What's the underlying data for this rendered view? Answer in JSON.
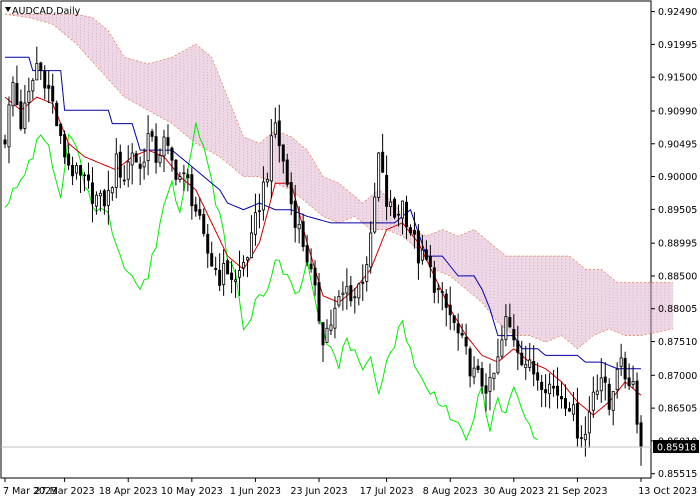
{
  "chart_data": {
    "type": "candlestick",
    "title": "AUDCAD,Daily",
    "symbol": "AUDCAD",
    "timeframe": "Daily",
    "ylim": [
      0.8545,
      0.9265
    ],
    "y_ticks": [
      "0.92490",
      "0.91995",
      "0.91500",
      "0.90990",
      "0.90495",
      "0.90000",
      "0.89505",
      "0.88995",
      "0.88500",
      "0.88005",
      "0.87510",
      "0.87000",
      "0.86505",
      "0.86010",
      "0.85515"
    ],
    "x_ticks": [
      "7 Mar 2023",
      "27 Mar 2023",
      "18 Apr 2023",
      "10 May 2023",
      "1 Jun 2023",
      "23 Jun 2023",
      "17 Jul 2023",
      "8 Aug 2023",
      "30 Aug 2023",
      "21 Sep 2023",
      "13 Oct 2023"
    ],
    "last_price": "0.85918",
    "grid": false,
    "indicators": [
      "Ichimoku Kinko Hyo (Tenkan-sen, Kijun-sen, Chikou span, Kumo cloud)"
    ],
    "colors": {
      "candle": "#000000",
      "tenkan": "#cc0000",
      "kijun": "#0000aa",
      "chikou": "#00ee00",
      "cloud": "#e88a60",
      "cloud_fill": "#d9a8c8",
      "price_tag_bg": "#000000",
      "last_price_line": "#c0c0c0"
    },
    "close_anchors": [
      [
        0,
        0.906
      ],
      [
        2,
        0.914
      ],
      [
        4,
        0.908
      ],
      [
        6,
        0.912
      ],
      [
        8,
        0.917
      ],
      [
        10,
        0.915
      ],
      [
        12,
        0.911
      ],
      [
        14,
        0.905
      ],
      [
        16,
        0.902
      ],
      [
        18,
        0.9
      ],
      [
        20,
        0.899
      ],
      [
        22,
        0.8975
      ],
      [
        24,
        0.896
      ],
      [
        26,
        0.897
      ],
      [
        28,
        0.902
      ],
      [
        30,
        0.9
      ],
      [
        32,
        0.904
      ],
      [
        34,
        0.901
      ],
      [
        36,
        0.906
      ],
      [
        38,
        0.903
      ],
      [
        40,
        0.905
      ],
      [
        42,
        0.902
      ],
      [
        44,
        0.9
      ],
      [
        46,
        0.899
      ],
      [
        48,
        0.895
      ],
      [
        50,
        0.89
      ],
      [
        52,
        0.887
      ],
      [
        54,
        0.885
      ],
      [
        56,
        0.886
      ],
      [
        58,
        0.884
      ],
      [
        60,
        0.887
      ],
      [
        62,
        0.89
      ],
      [
        64,
        0.896
      ],
      [
        66,
        0.901
      ],
      [
        68,
        0.908
      ],
      [
        70,
        0.902
      ],
      [
        72,
        0.896
      ],
      [
        74,
        0.892
      ],
      [
        76,
        0.888
      ],
      [
        78,
        0.882
      ],
      [
        80,
        0.876
      ],
      [
        82,
        0.878
      ],
      [
        84,
        0.881
      ],
      [
        86,
        0.883
      ],
      [
        88,
        0.882
      ],
      [
        90,
        0.885
      ],
      [
        92,
        0.89
      ],
      [
        94,
        0.903
      ],
      [
        96,
        0.896
      ],
      [
        98,
        0.894
      ],
      [
        100,
        0.896
      ],
      [
        102,
        0.892
      ],
      [
        104,
        0.888
      ],
      [
        106,
        0.887
      ],
      [
        108,
        0.884
      ],
      [
        110,
        0.881
      ],
      [
        112,
        0.879
      ],
      [
        114,
        0.876
      ],
      [
        116,
        0.873
      ],
      [
        118,
        0.87
      ],
      [
        120,
        0.869
      ],
      [
        122,
        0.868
      ],
      [
        124,
        0.872
      ],
      [
        126,
        0.878
      ],
      [
        128,
        0.876
      ],
      [
        130,
        0.873
      ],
      [
        132,
        0.871
      ],
      [
        134,
        0.87
      ],
      [
        136,
        0.869
      ],
      [
        138,
        0.868
      ],
      [
        140,
        0.867
      ],
      [
        142,
        0.866
      ],
      [
        144,
        0.862
      ],
      [
        146,
        0.861
      ],
      [
        148,
        0.868
      ],
      [
        150,
        0.87
      ],
      [
        152,
        0.865
      ],
      [
        154,
        0.872
      ],
      [
        156,
        0.87
      ],
      [
        158,
        0.869
      ],
      [
        160,
        0.8592
      ]
    ],
    "kijun_anchors": [
      [
        0,
        0.918
      ],
      [
        6,
        0.918
      ],
      [
        6,
        0.916
      ],
      [
        14,
        0.916
      ],
      [
        14,
        0.91
      ],
      [
        26,
        0.91
      ],
      [
        26,
        0.908
      ],
      [
        32,
        0.908
      ],
      [
        34,
        0.904
      ],
      [
        40,
        0.904
      ],
      [
        42,
        0.904
      ],
      [
        46,
        0.902
      ],
      [
        50,
        0.9
      ],
      [
        54,
        0.898
      ],
      [
        56,
        0.896
      ],
      [
        60,
        0.895
      ],
      [
        64,
        0.896
      ],
      [
        68,
        0.895
      ],
      [
        72,
        0.895
      ],
      [
        76,
        0.894
      ],
      [
        82,
        0.893
      ],
      [
        86,
        0.893
      ],
      [
        90,
        0.893
      ],
      [
        94,
        0.893
      ],
      [
        98,
        0.893
      ],
      [
        102,
        0.895
      ],
      [
        106,
        0.888
      ],
      [
        110,
        0.888
      ],
      [
        114,
        0.885
      ],
      [
        118,
        0.885
      ],
      [
        120,
        0.883
      ],
      [
        122,
        0.88
      ],
      [
        124,
        0.876
      ],
      [
        128,
        0.876
      ],
      [
        130,
        0.874
      ],
      [
        134,
        0.874
      ],
      [
        136,
        0.873
      ],
      [
        140,
        0.873
      ],
      [
        144,
        0.873
      ],
      [
        146,
        0.872
      ],
      [
        150,
        0.872
      ],
      [
        154,
        0.871
      ],
      [
        158,
        0.871
      ],
      [
        160,
        0.871
      ]
    ],
    "tenkan_anchors": [
      [
        0,
        0.912
      ],
      [
        4,
        0.91
      ],
      [
        8,
        0.912
      ],
      [
        12,
        0.911
      ],
      [
        16,
        0.905
      ],
      [
        20,
        0.903
      ],
      [
        24,
        0.902
      ],
      [
        28,
        0.901
      ],
      [
        32,
        0.903
      ],
      [
        36,
        0.904
      ],
      [
        40,
        0.903
      ],
      [
        44,
        0.9
      ],
      [
        48,
        0.898
      ],
      [
        52,
        0.893
      ],
      [
        56,
        0.888
      ],
      [
        60,
        0.886
      ],
      [
        64,
        0.89
      ],
      [
        68,
        0.899
      ],
      [
        72,
        0.899
      ],
      [
        76,
        0.89
      ],
      [
        80,
        0.882
      ],
      [
        84,
        0.881
      ],
      [
        88,
        0.883
      ],
      [
        92,
        0.886
      ],
      [
        96,
        0.892
      ],
      [
        100,
        0.893
      ],
      [
        104,
        0.89
      ],
      [
        108,
        0.885
      ],
      [
        112,
        0.88
      ],
      [
        116,
        0.876
      ],
      [
        120,
        0.873
      ],
      [
        124,
        0.872
      ],
      [
        128,
        0.874
      ],
      [
        132,
        0.872
      ],
      [
        136,
        0.871
      ],
      [
        140,
        0.869
      ],
      [
        144,
        0.866
      ],
      [
        148,
        0.864
      ],
      [
        152,
        0.866
      ],
      [
        156,
        0.869
      ],
      [
        160,
        0.867
      ]
    ],
    "chikou_anchors": [
      [
        0,
        0.896
      ],
      [
        4,
        0.899
      ],
      [
        8,
        0.905
      ],
      [
        10,
        0.906
      ],
      [
        12,
        0.902
      ],
      [
        14,
        0.896
      ],
      [
        16,
        0.906
      ],
      [
        18,
        0.904
      ],
      [
        20,
        0.899
      ],
      [
        22,
        0.896
      ],
      [
        26,
        0.894
      ],
      [
        28,
        0.89
      ],
      [
        30,
        0.887
      ],
      [
        34,
        0.883
      ],
      [
        36,
        0.885
      ],
      [
        38,
        0.89
      ],
      [
        40,
        0.896
      ],
      [
        42,
        0.899
      ],
      [
        44,
        0.895
      ],
      [
        46,
        0.902
      ],
      [
        48,
        0.908
      ],
      [
        50,
        0.904
      ],
      [
        52,
        0.899
      ],
      [
        54,
        0.894
      ],
      [
        56,
        0.888
      ],
      [
        58,
        0.885
      ],
      [
        60,
        0.877
      ],
      [
        62,
        0.879
      ],
      [
        64,
        0.883
      ],
      [
        66,
        0.882
      ],
      [
        68,
        0.888
      ],
      [
        70,
        0.885
      ],
      [
        72,
        0.884
      ],
      [
        74,
        0.882
      ],
      [
        76,
        0.888
      ],
      [
        78,
        0.882
      ],
      [
        80,
        0.877
      ],
      [
        82,
        0.874
      ],
      [
        84,
        0.871
      ],
      [
        86,
        0.876
      ],
      [
        88,
        0.873
      ],
      [
        90,
        0.87
      ],
      [
        92,
        0.872
      ],
      [
        94,
        0.868
      ],
      [
        96,
        0.872
      ],
      [
        98,
        0.875
      ],
      [
        100,
        0.878
      ],
      [
        102,
        0.874
      ],
      [
        104,
        0.87
      ],
      [
        106,
        0.868
      ],
      [
        108,
        0.867
      ],
      [
        110,
        0.866
      ],
      [
        112,
        0.864
      ],
      [
        114,
        0.862
      ],
      [
        116,
        0.86
      ],
      [
        118,
        0.864
      ],
      [
        120,
        0.868
      ],
      [
        122,
        0.862
      ],
      [
        124,
        0.866
      ],
      [
        126,
        0.864
      ],
      [
        128,
        0.868
      ],
      [
        130,
        0.865
      ],
      [
        132,
        0.862
      ],
      [
        134,
        0.861
      ]
    ],
    "cloud_top_anchors": [
      [
        0,
        0.9245
      ],
      [
        10,
        0.9245
      ],
      [
        18,
        0.9245
      ],
      [
        22,
        0.924
      ],
      [
        26,
        0.922
      ],
      [
        30,
        0.918
      ],
      [
        36,
        0.917
      ],
      [
        42,
        0.918
      ],
      [
        48,
        0.92
      ],
      [
        52,
        0.918
      ],
      [
        56,
        0.912
      ],
      [
        60,
        0.906
      ],
      [
        64,
        0.905
      ],
      [
        68,
        0.907
      ],
      [
        72,
        0.906
      ],
      [
        76,
        0.904
      ],
      [
        80,
        0.9
      ],
      [
        84,
        0.899
      ],
      [
        90,
        0.896
      ],
      [
        94,
        0.898
      ],
      [
        98,
        0.896
      ],
      [
        102,
        0.892
      ],
      [
        106,
        0.891
      ],
      [
        110,
        0.892
      ],
      [
        114,
        0.891
      ],
      [
        118,
        0.892
      ],
      [
        122,
        0.89
      ],
      [
        126,
        0.888
      ],
      [
        130,
        0.888
      ],
      [
        134,
        0.888
      ],
      [
        138,
        0.888
      ],
      [
        142,
        0.888
      ],
      [
        146,
        0.886
      ],
      [
        150,
        0.886
      ],
      [
        154,
        0.884
      ],
      [
        158,
        0.884
      ],
      [
        160,
        0.884
      ],
      [
        168,
        0.884
      ]
    ],
    "cloud_bottom_anchors": [
      [
        0,
        0.9245
      ],
      [
        6,
        0.924
      ],
      [
        12,
        0.923
      ],
      [
        18,
        0.92
      ],
      [
        24,
        0.916
      ],
      [
        30,
        0.912
      ],
      [
        36,
        0.91
      ],
      [
        42,
        0.908
      ],
      [
        48,
        0.905
      ],
      [
        54,
        0.903
      ],
      [
        60,
        0.9
      ],
      [
        64,
        0.9
      ],
      [
        68,
        0.899
      ],
      [
        72,
        0.898
      ],
      [
        76,
        0.896
      ],
      [
        80,
        0.894
      ],
      [
        84,
        0.893
      ],
      [
        88,
        0.894
      ],
      [
        92,
        0.892
      ],
      [
        96,
        0.892
      ],
      [
        100,
        0.891
      ],
      [
        104,
        0.889
      ],
      [
        108,
        0.886
      ],
      [
        112,
        0.885
      ],
      [
        116,
        0.883
      ],
      [
        120,
        0.881
      ],
      [
        124,
        0.878
      ],
      [
        128,
        0.876
      ],
      [
        132,
        0.876
      ],
      [
        136,
        0.875
      ],
      [
        140,
        0.876
      ],
      [
        144,
        0.874
      ],
      [
        148,
        0.876
      ],
      [
        152,
        0.877
      ],
      [
        156,
        0.876
      ],
      [
        160,
        0.876
      ],
      [
        168,
        0.877
      ]
    ]
  }
}
